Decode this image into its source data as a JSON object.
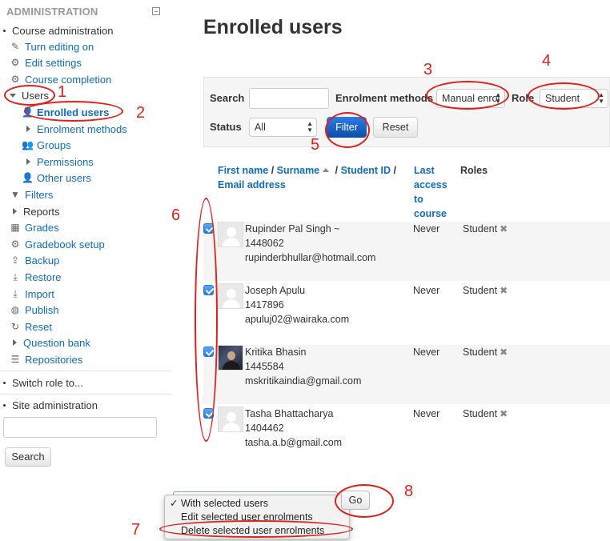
{
  "sidebar": {
    "header": "ADMINISTRATION",
    "course_administration": "Course administration",
    "items": [
      {
        "label": "Turn editing on",
        "icon": "pencil-icon"
      },
      {
        "label": "Edit settings",
        "icon": "gear-icon"
      },
      {
        "label": "Course completion",
        "icon": "gear-icon"
      },
      {
        "label": "Users",
        "icon": "triangle-down-icon"
      },
      {
        "label": "Enrolled users",
        "icon": "user-icon"
      },
      {
        "label": "Enrolment methods",
        "icon": "triangle-right-icon"
      },
      {
        "label": "Groups",
        "icon": "users-icon"
      },
      {
        "label": "Permissions",
        "icon": "triangle-right-icon"
      },
      {
        "label": "Other users",
        "icon": "user-icon"
      },
      {
        "label": "Filters",
        "icon": "filter-icon"
      },
      {
        "label": "Reports",
        "icon": "triangle-right-icon"
      },
      {
        "label": "Grades",
        "icon": "table-icon"
      },
      {
        "label": "Gradebook setup",
        "icon": "gear-icon"
      },
      {
        "label": "Backup",
        "icon": "upload-icon"
      },
      {
        "label": "Restore",
        "icon": "download-icon"
      },
      {
        "label": "Import",
        "icon": "import-icon"
      },
      {
        "label": "Publish",
        "icon": "globe-icon"
      },
      {
        "label": "Reset",
        "icon": "reset-icon"
      },
      {
        "label": "Question bank",
        "icon": "triangle-right-icon"
      },
      {
        "label": "Repositories",
        "icon": "database-icon"
      }
    ],
    "switch_role": "Switch role to...",
    "site_administration": "Site administration",
    "search_button": "Search"
  },
  "main": {
    "title": "Enrolled users",
    "filter": {
      "search_label": "Search",
      "search_value": "",
      "enrolment_methods_label": "Enrolment methods",
      "enrolment_methods_value": "Manual enrol",
      "role_label": "Role",
      "role_value": "Student",
      "status_label": "Status",
      "status_value": "All",
      "filter_button": "Filter",
      "reset_button": "Reset"
    },
    "table": {
      "col_first_name": "First name",
      "slash1": " / ",
      "col_surname": "Surname",
      "slash2": " / ",
      "col_student_id": "Student ID",
      "slash3": " /",
      "col_email": "Email address",
      "col_last_access": [
        "Last",
        "access",
        "to",
        "course"
      ],
      "col_roles": "Roles",
      "rows": [
        {
          "name": "Rupinder Pal Singh ~",
          "id": "1448062",
          "email": "rupinderbhullar@hotmail.com",
          "access": "Never",
          "role": "Student",
          "checked": true,
          "photo": false
        },
        {
          "name": "Joseph Apulu",
          "id": "1417896",
          "email": "apuluj02@wairaka.com",
          "access": "Never",
          "role": "Student",
          "checked": true,
          "photo": false
        },
        {
          "name": "Kritika Bhasin",
          "id": "1445584",
          "email": "mskritikaindia@gmail.com",
          "access": "Never",
          "role": "Student",
          "checked": true,
          "photo": true
        },
        {
          "name": "Tasha Bhattacharya",
          "id": "1404462",
          "email": "tasha.a.b@gmail.com",
          "access": "Never",
          "role": "Student",
          "checked": true,
          "photo": false
        }
      ]
    },
    "bulk": {
      "options": [
        "With selected users",
        "Edit selected user enrolments",
        "Delete selected user enrolments"
      ],
      "selected_mark": "✓",
      "go_button": "Go"
    }
  },
  "annotations": [
    "1",
    "2",
    "3",
    "4",
    "5",
    "6",
    "7",
    "8"
  ],
  "colors": {
    "link": "#0f6cbf",
    "annotation": "#e0201a",
    "filter_button": "#0a4fa6"
  }
}
